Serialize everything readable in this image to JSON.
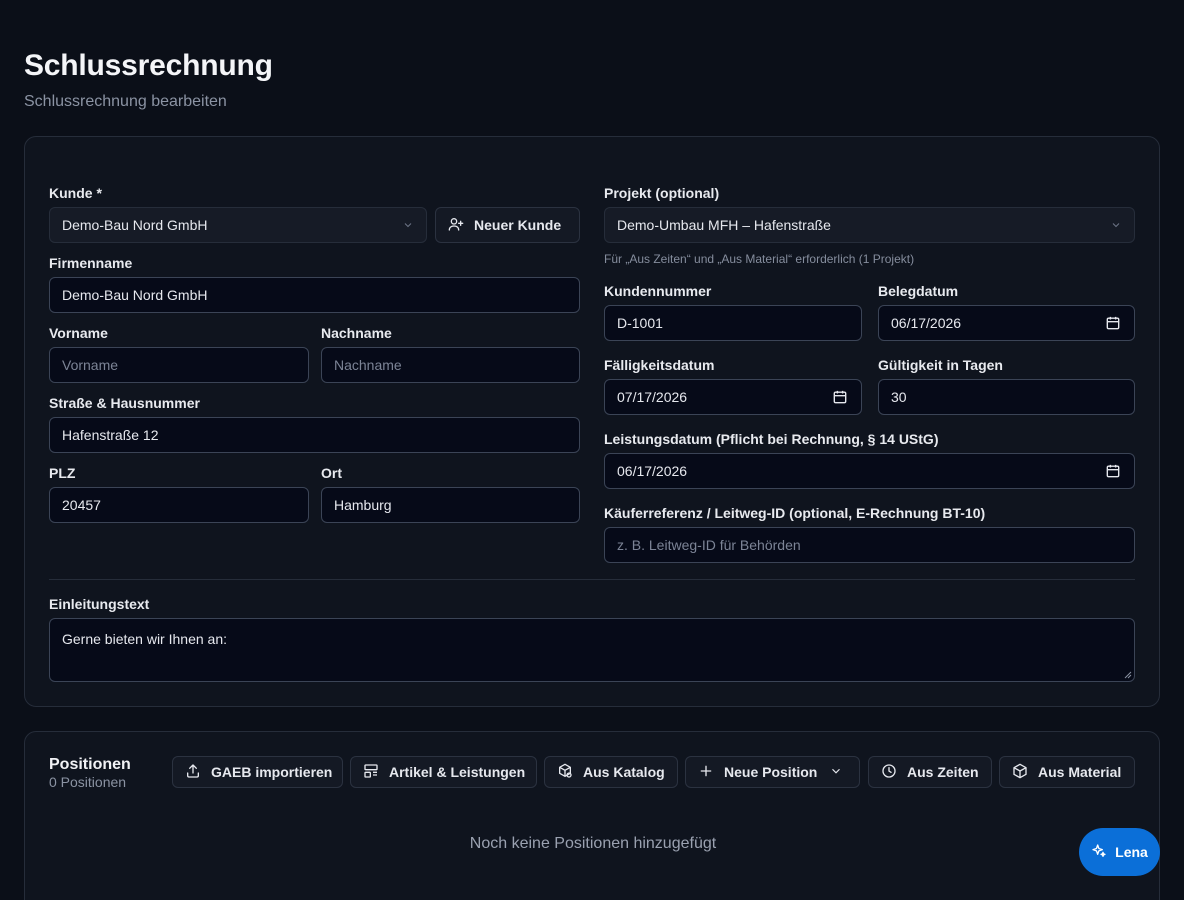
{
  "header": {
    "title": "Schlussrechnung",
    "subtitle": "Schlussrechnung bearbeiten"
  },
  "form": {
    "customer": {
      "label": "Kunde *",
      "value": "Demo-Bau Nord GmbH",
      "new_button": "Neuer Kunde"
    },
    "company": {
      "label": "Firmenname",
      "value": "Demo-Bau Nord GmbH"
    },
    "first_name": {
      "label": "Vorname",
      "placeholder": "Vorname"
    },
    "last_name": {
      "label": "Nachname",
      "placeholder": "Nachname"
    },
    "street": {
      "label": "Straße & Hausnummer",
      "value": "Hafenstraße 12"
    },
    "zip": {
      "label": "PLZ",
      "value": "20457"
    },
    "city": {
      "label": "Ort",
      "value": "Hamburg"
    },
    "project": {
      "label": "Projekt (optional)",
      "value": "Demo-Umbau MFH – Hafenstraße",
      "hint": "Für „Aus Zeiten“ und „Aus Material“ erforderlich (1 Projekt)"
    },
    "customer_number": {
      "label": "Kundennummer",
      "value": "D-1001"
    },
    "document_date": {
      "label": "Belegdatum",
      "value": "06/17/2026"
    },
    "due_date": {
      "label": "Fälligkeitsdatum",
      "value": "07/17/2026"
    },
    "validity": {
      "label": "Gültigkeit in Tagen",
      "value": "30"
    },
    "service_date": {
      "label": "Leistungsdatum (Pflicht bei Rechnung, § 14 UStG)",
      "value": "06/17/2026"
    },
    "buyer_reference": {
      "label": "Käuferreferenz / Leitweg-ID (optional, E-Rechnung BT-10)",
      "placeholder": "z. B. Leitweg-ID für Behörden"
    },
    "intro": {
      "label": "Einleitungstext",
      "value": "Gerne bieten wir Ihnen an:"
    }
  },
  "positions": {
    "title": "Positionen",
    "count": "0 Positionen",
    "buttons": {
      "gaeb": "GAEB importieren",
      "articles": "Artikel & Leistungen",
      "catalog": "Aus Katalog",
      "new_position": "Neue Position",
      "times": "Aus Zeiten",
      "material": "Aus Material"
    },
    "empty": "Noch keine Positionen hinzugefügt"
  },
  "assistant": {
    "label": "Lena"
  },
  "colors": {
    "background": "#0b0f18",
    "card": "#0f141e",
    "input": "#060a18",
    "accent": "#0b6fd8"
  },
  "icons": [
    "user-plus-icon",
    "chevron-down-icon",
    "calendar-icon",
    "upload-icon",
    "layout-icon",
    "package-search-icon",
    "plus-icon",
    "clock-icon",
    "box-icon",
    "sparkles-icon"
  ]
}
